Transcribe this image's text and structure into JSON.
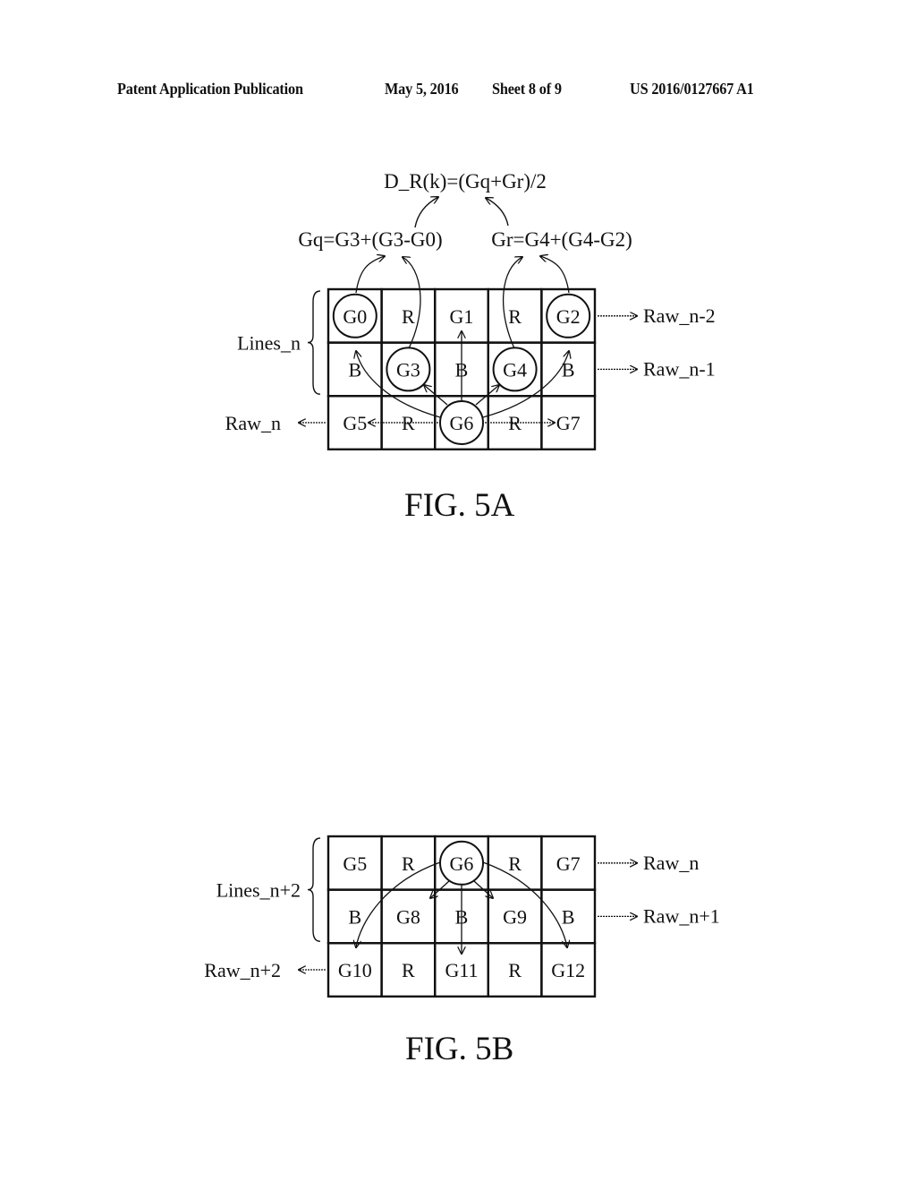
{
  "header": {
    "publication": "Patent Application Publication",
    "date": "May 5, 2016",
    "sheet": "Sheet 8 of 9",
    "number": "US 2016/0127667 A1"
  },
  "fig5a": {
    "caption": "FIG. 5A",
    "formula_top": "D_R(k)=(Gq+Gr)/2",
    "formula_gq": "Gq=G3+(G3-G0)",
    "formula_gr": "Gr=G4+(G4-G2)",
    "brace_label": "Lines_n",
    "rows": [
      {
        "cells": [
          "G0",
          "R",
          "G1",
          "R",
          "G2"
        ],
        "label": "Raw_n-2"
      },
      {
        "cells": [
          "B",
          "G3",
          "B",
          "G4",
          "B"
        ],
        "label": "Raw_n-1"
      },
      {
        "cells": [
          "G5",
          "R",
          "G6",
          "R",
          "G7"
        ],
        "label": "Raw_n"
      }
    ],
    "circled": [
      "G0",
      "G2",
      "G3",
      "G4",
      "G6"
    ]
  },
  "fig5b": {
    "caption": "FIG. 5B",
    "brace_label": "Lines_n+2",
    "rows": [
      {
        "cells": [
          "G5",
          "R",
          "G6",
          "R",
          "G7"
        ],
        "label": "Raw_n"
      },
      {
        "cells": [
          "B",
          "G8",
          "B",
          "G9",
          "B"
        ],
        "label": "Raw_n+1"
      },
      {
        "cells": [
          "G10",
          "R",
          "G11",
          "R",
          "G12"
        ],
        "label": "Raw_n+2"
      }
    ],
    "circled": [
      "G6"
    ]
  }
}
